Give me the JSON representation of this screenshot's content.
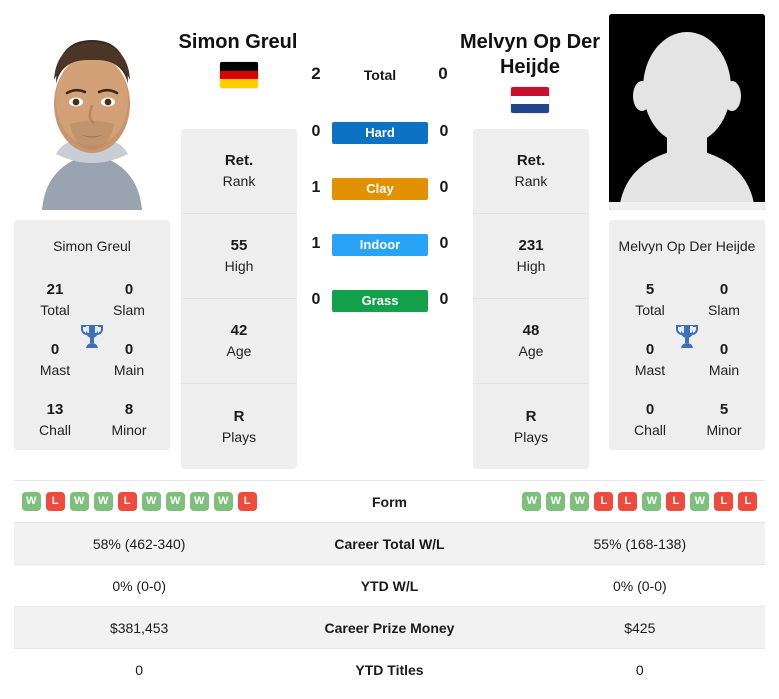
{
  "players": {
    "left": {
      "name": "Simon Greul",
      "panel_name": "Simon Greul",
      "flag": "germany-flag",
      "flag_bands": [
        "#000000",
        "#dd0000",
        "#ffce00"
      ],
      "photo": "player-portrait-photo",
      "rank": {
        "value": "Ret.",
        "label": "Rank"
      },
      "high": {
        "value": "55",
        "label": "High"
      },
      "age": {
        "value": "42",
        "label": "Age"
      },
      "plays": {
        "value": "R",
        "label": "Plays"
      },
      "titles": {
        "total": {
          "value": "21",
          "label": "Total"
        },
        "slam": {
          "value": "0",
          "label": "Slam"
        },
        "mast": {
          "value": "0",
          "label": "Mast"
        },
        "main": {
          "value": "0",
          "label": "Main"
        },
        "chall": {
          "value": "13",
          "label": "Chall"
        },
        "minor": {
          "value": "8",
          "label": "Minor"
        }
      },
      "form": [
        "W",
        "L",
        "W",
        "W",
        "L",
        "W",
        "W",
        "W",
        "W",
        "L"
      ],
      "career_total_wl": "58% (462-340)",
      "ytd_wl": "0% (0-0)",
      "career_prize_money": "$381,453",
      "ytd_titles": "0"
    },
    "right": {
      "name": "Melvyn Op Der Heijde",
      "panel_name": "Melvyn Op Der Heijde",
      "flag": "netherlands-flag",
      "flag_bands": [
        "#c8102e",
        "#ffffff",
        "#21468b"
      ],
      "photo": "player-placeholder-silhouette",
      "rank": {
        "value": "Ret.",
        "label": "Rank"
      },
      "high": {
        "value": "231",
        "label": "High"
      },
      "age": {
        "value": "48",
        "label": "Age"
      },
      "plays": {
        "value": "R",
        "label": "Plays"
      },
      "titles": {
        "total": {
          "value": "5",
          "label": "Total"
        },
        "slam": {
          "value": "0",
          "label": "Slam"
        },
        "mast": {
          "value": "0",
          "label": "Mast"
        },
        "main": {
          "value": "0",
          "label": "Main"
        },
        "chall": {
          "value": "0",
          "label": "Chall"
        },
        "minor": {
          "value": "5",
          "label": "Minor"
        }
      },
      "form": [
        "W",
        "W",
        "W",
        "L",
        "L",
        "W",
        "L",
        "W",
        "L",
        "L"
      ],
      "career_total_wl": "55% (168-138)",
      "ytd_wl": "0% (0-0)",
      "career_prize_money": "$425",
      "ytd_titles": "0"
    }
  },
  "h2h": {
    "total": {
      "label": "Total",
      "left": "2",
      "right": "0"
    },
    "surfaces": [
      {
        "label": "Hard",
        "left": "0",
        "right": "0",
        "color": "#0b72c4"
      },
      {
        "label": "Clay",
        "left": "1",
        "right": "0",
        "color": "#e29100"
      },
      {
        "label": "Indoor",
        "left": "1",
        "right": "0",
        "color": "#29a3f5"
      },
      {
        "label": "Grass",
        "left": "0",
        "right": "0",
        "color": "#13a04a"
      }
    ]
  },
  "table": {
    "rows": [
      {
        "label": "Form",
        "type": "form"
      },
      {
        "label": "Career Total W/L",
        "type": "text",
        "left": "58% (462-340)",
        "right": "55% (168-138)"
      },
      {
        "label": "YTD W/L",
        "type": "text",
        "left": "0% (0-0)",
        "right": "0% (0-0)"
      },
      {
        "label": "Career Prize Money",
        "type": "text",
        "left": "$381,453",
        "right": "$425"
      },
      {
        "label": "YTD Titles",
        "type": "text",
        "left": "0",
        "right": "0"
      }
    ]
  },
  "colors": {
    "win_badge": "#7cc07c",
    "loss_badge": "#ef4b3c",
    "panel_bg": "#eeeeee",
    "row_alt_bg": "#f2f2f2",
    "trophy": "#3f6fb5"
  }
}
